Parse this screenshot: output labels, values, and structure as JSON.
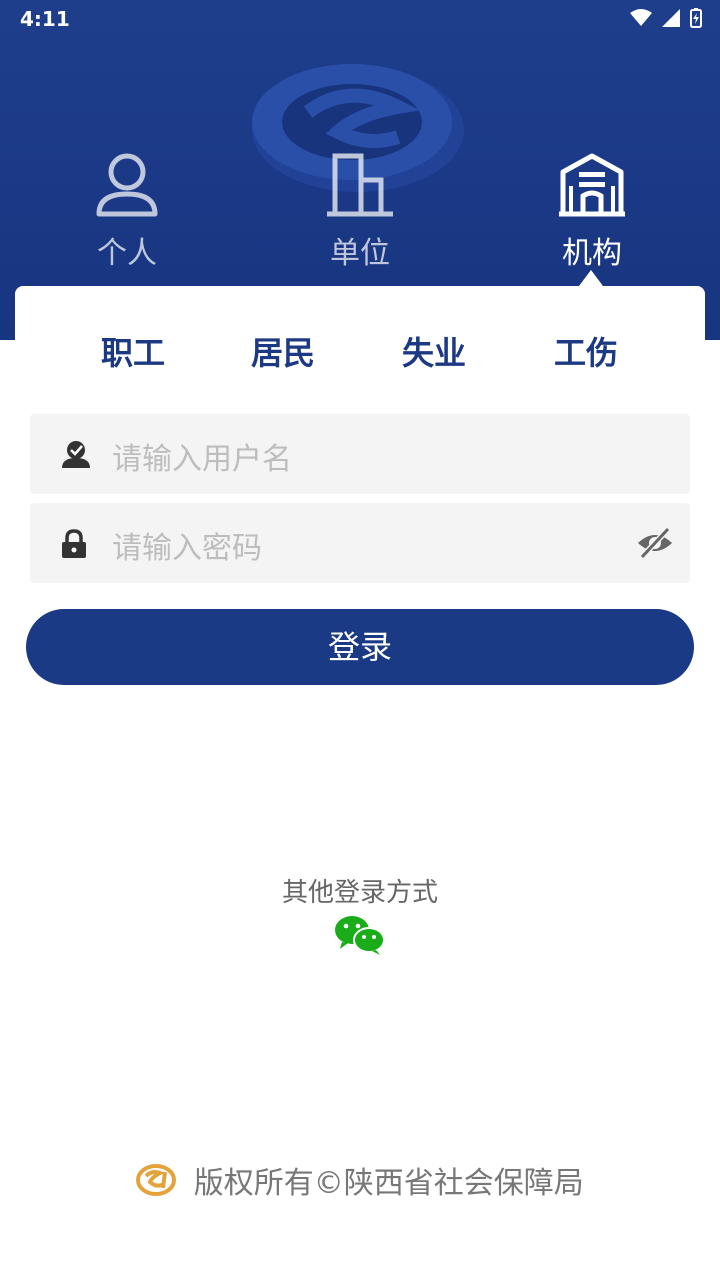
{
  "status_bar": {
    "time": "4:11"
  },
  "role_tabs": [
    {
      "label": "个人",
      "icon": "person-icon",
      "active": false
    },
    {
      "label": "单位",
      "icon": "building-icon",
      "active": false
    },
    {
      "label": "机构",
      "icon": "institution-icon",
      "active": true
    }
  ],
  "sub_tabs": [
    {
      "label": "职工"
    },
    {
      "label": "居民"
    },
    {
      "label": "失业"
    },
    {
      "label": "工伤"
    }
  ],
  "login_form": {
    "username_placeholder": "请输入用户名",
    "password_placeholder": "请输入密码",
    "login_label": "登录"
  },
  "other_login": {
    "label": "其他登录方式",
    "wechat_color": "#1aad19"
  },
  "footer": {
    "text": "版权所有©陕西省社会保障局",
    "logo_color": "#e3a33a"
  },
  "colors": {
    "brand": "#1b3a86",
    "header": "#1e3e8c"
  }
}
